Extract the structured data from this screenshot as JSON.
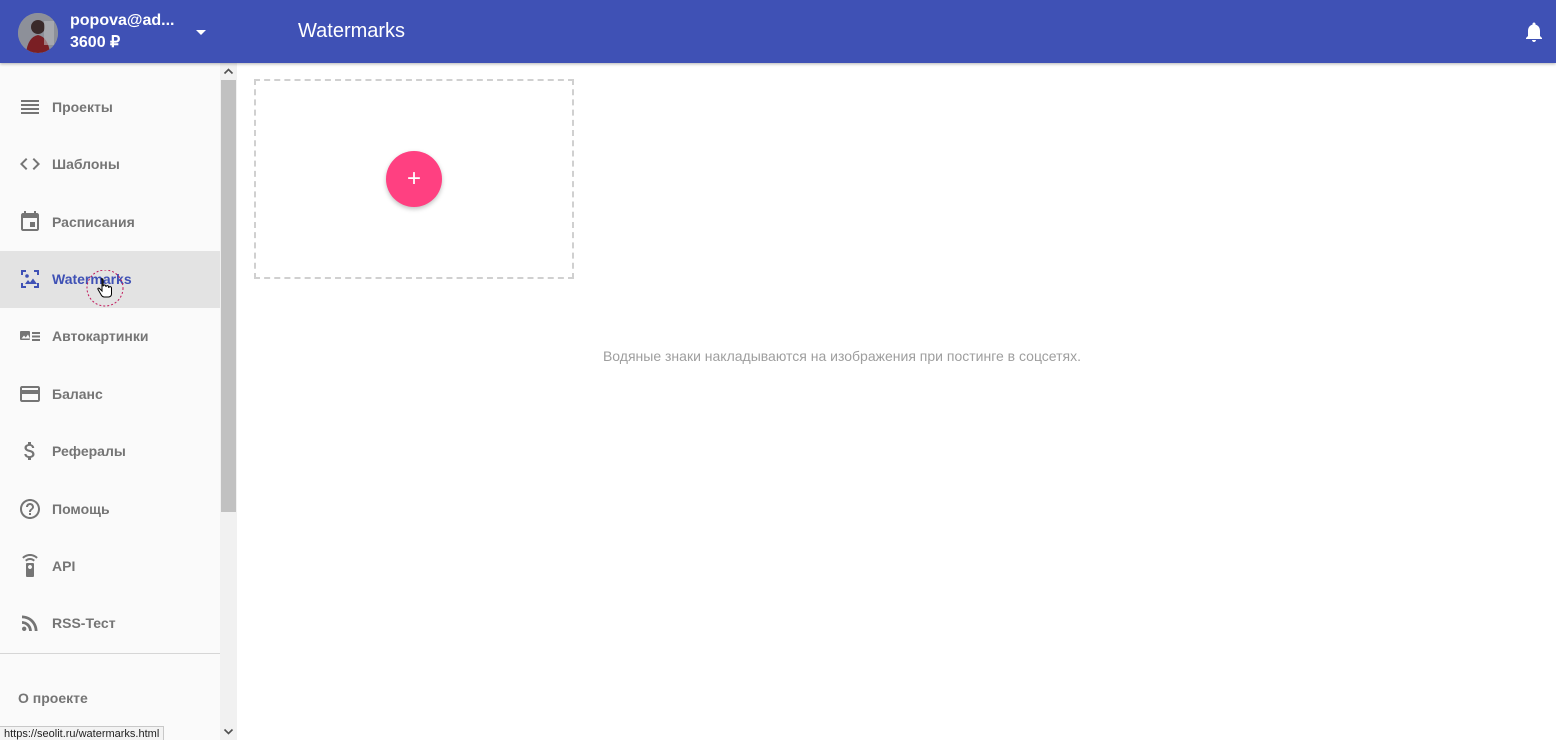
{
  "header": {
    "user_email": "popova@ad...",
    "user_balance": "3600 ₽",
    "page_title": "Watermarks",
    "accent_color": "#3f51b5"
  },
  "sidebar": {
    "items": [
      {
        "label": "Проекты",
        "icon": "list-icon"
      },
      {
        "label": "Шаблоны",
        "icon": "code-icon"
      },
      {
        "label": "Расписания",
        "icon": "calendar-icon"
      },
      {
        "label": "Watermarks",
        "icon": "watermark-image-icon",
        "active": true
      },
      {
        "label": "Автокартинки",
        "icon": "auto-image-icon"
      },
      {
        "label": "Баланс",
        "icon": "credit-card-icon"
      },
      {
        "label": "Рефералы",
        "icon": "dollar-icon"
      },
      {
        "label": "Помощь",
        "icon": "help-circle-icon"
      },
      {
        "label": "API",
        "icon": "remote-icon"
      },
      {
        "label": "RSS-Тест",
        "icon": "rss-icon"
      }
    ],
    "about_label": "О проекте"
  },
  "main": {
    "add_button_label": "+",
    "info_text": "Водяные знаки накладываются на изображения при постинге в соцсетях.",
    "fab_color": "#ff4081"
  },
  "status_bar": {
    "url": "https://seolit.ru/watermarks.html"
  }
}
